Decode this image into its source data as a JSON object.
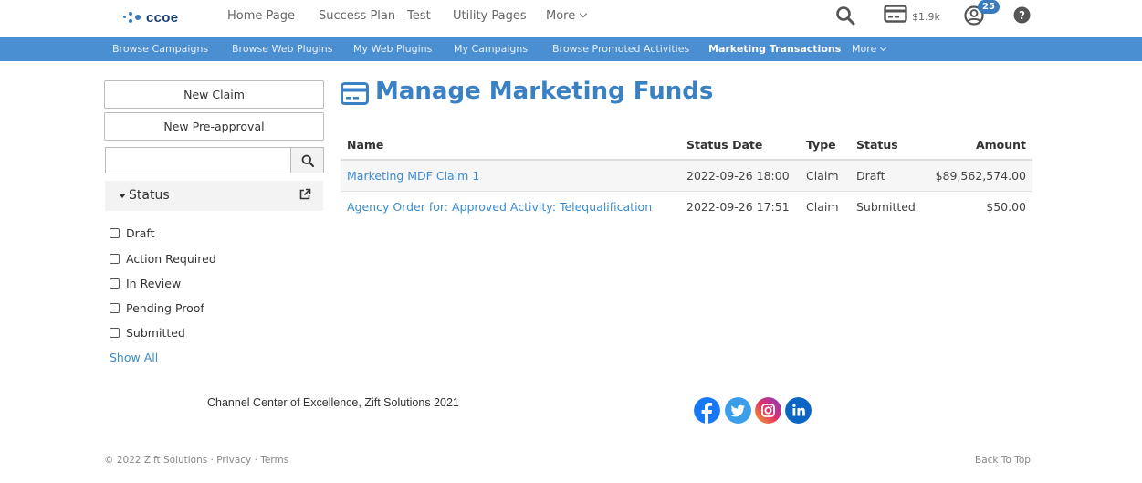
{
  "header": {
    "logo_text": "ccoe",
    "nav": [
      {
        "label": "Home Page"
      },
      {
        "label": "Success Plan - Test"
      },
      {
        "label": "Utility Pages"
      },
      {
        "label": "More"
      }
    ],
    "wallet_amount": "$1.9k",
    "notification_count": "25",
    "icons": [
      "search-icon",
      "wallet-icon",
      "user-icon",
      "help-icon"
    ]
  },
  "subnav": {
    "items": [
      {
        "label": "Browse Campaigns"
      },
      {
        "label": "Browse Web Plugins"
      },
      {
        "label": "My Web Plugins"
      },
      {
        "label": "My Campaigns"
      },
      {
        "label": "Browse Promoted Activities"
      },
      {
        "label": "Marketing Transactions"
      },
      {
        "label": "More"
      }
    ],
    "active": "Marketing Transactions"
  },
  "sidebar": {
    "new_claim_label": "New Claim",
    "new_preapproval_label": "New Pre-approval",
    "search_placeholder": "",
    "status_title": "Status",
    "filters": [
      {
        "label": "Draft",
        "checked": false
      },
      {
        "label": "Action Required",
        "checked": false
      },
      {
        "label": "In Review",
        "checked": false
      },
      {
        "label": "Pending Proof",
        "checked": false
      },
      {
        "label": "Submitted",
        "checked": false
      }
    ],
    "show_all_label": "Show All"
  },
  "main": {
    "title": "Manage Marketing Funds",
    "columns": [
      "Name",
      "Status Date",
      "Type",
      "Status",
      "Amount"
    ],
    "rows": [
      {
        "name": "Marketing MDF Claim 1",
        "status_date": "2022-09-26 18:00",
        "type": "Claim",
        "status": "Draft",
        "amount": "$89,562,574.00"
      },
      {
        "name": "Agency Order for: Approved Activity: Telequalification",
        "status_date": "2022-09-26 17:51",
        "type": "Claim",
        "status": "Submitted",
        "amount": "$50.00"
      }
    ]
  },
  "footer": {
    "text": "Channel Center of Excellence, Zift Solutions 2021",
    "social": [
      "facebook-icon",
      "twitter-icon",
      "instagram-icon",
      "linkedin-icon"
    ],
    "copyright": "© 2022 Zift Solutions · Privacy · Terms",
    "back_to_top": "Back To Top"
  },
  "colors": {
    "accent": "#3a80c4",
    "subnav_bg": "#4a8fd1",
    "link": "#3a8bd0"
  }
}
